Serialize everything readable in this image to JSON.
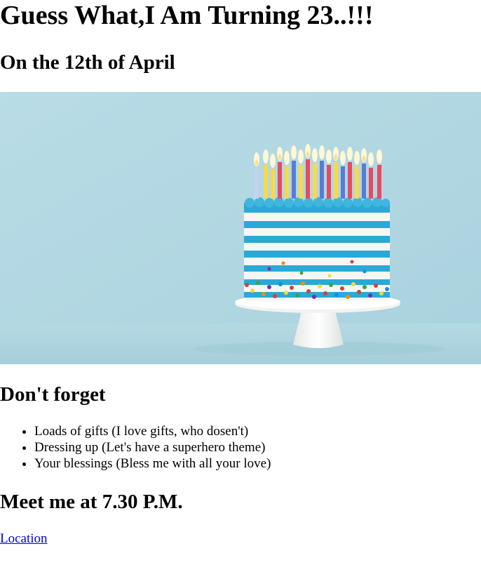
{
  "heading": "Guess What,I Am Turning 23..!!!",
  "date_heading": "On the 12th of April",
  "hero_image": {
    "alt": "birthday-cake-image",
    "colors": {
      "background": "#b8dbe6",
      "cake_blue": "#29a9d6",
      "cake_white": "#f6f7f5",
      "plate": "#f1f2f0"
    }
  },
  "reminders": {
    "title": "Don't forget",
    "items": [
      "Loads of gifts (I love gifts, who dosen't)",
      "Dressing up (Let's have a superhero theme)",
      "Your blessings (Bless me with all your love)"
    ]
  },
  "meet_heading": "Meet me at 7.30 P.M.",
  "location_link": "Location",
  "colors": {
    "link": "#0000ee",
    "text": "#000000"
  }
}
